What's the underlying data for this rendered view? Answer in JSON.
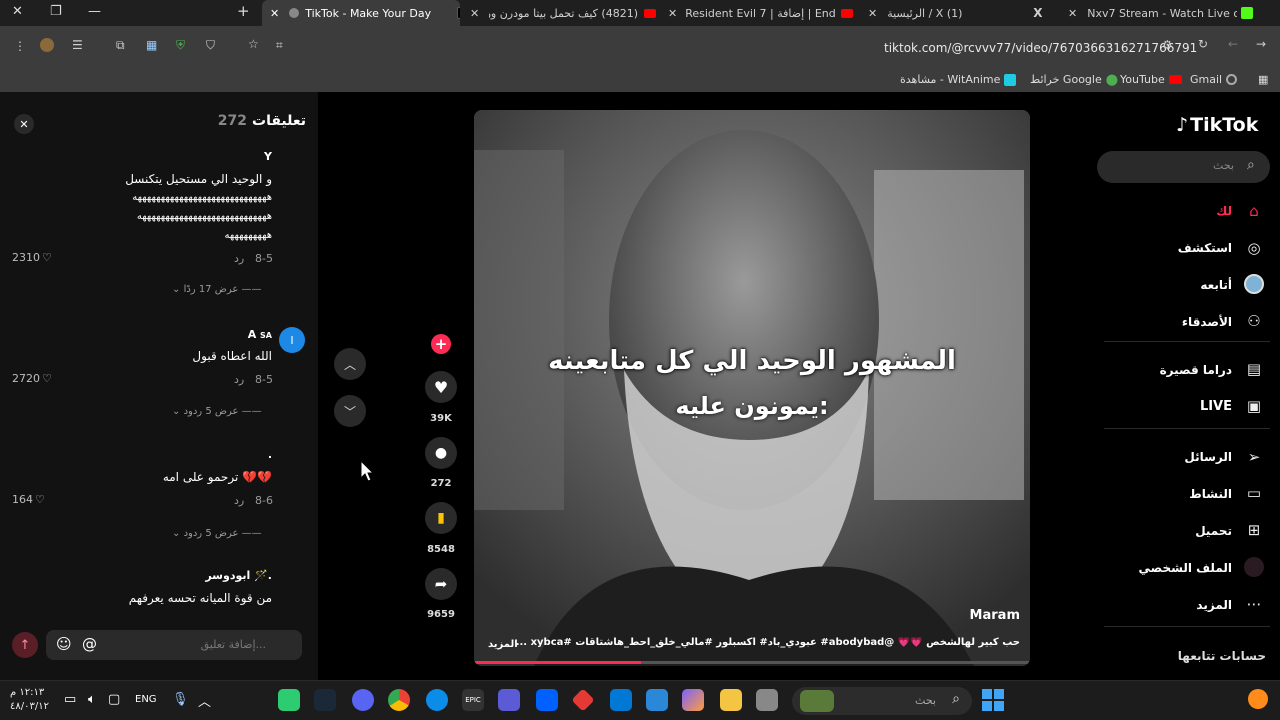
{
  "browser": {
    "tabs": [
      {
        "title": "TikTok - Make Your Day",
        "active": true
      },
      {
        "title": "(4821) كيف تحمل بيتا مودرن ورا..."
      },
      {
        "title": "Resident Evil 7 | إضافة | End of Z"
      },
      {
        "title": "الرئيسية / X (1)"
      },
      {
        "title": "Nxv7 Stream - Watch Live on K"
      }
    ],
    "url": "tiktok.com/@rcvvv77/video/7670366316271766791",
    "bookmarks": [
      "Gmail",
      "YouTube",
      "خرائط Google",
      "مشاهدة - WitAnime"
    ]
  },
  "comments_panel": {
    "title": "تعليقات",
    "count": "272",
    "close_label": "✕",
    "comments": [
      {
        "author": "Y",
        "lines": [
          "و الوحيد الي مستحيل يتكنسل",
          "هههههههههههههههههههههههههههههه",
          "ههههههههههههههههههههههههههههه",
          "هههههههههه"
        ],
        "date": "8-5",
        "reply": "رد",
        "likes": "2310",
        "view_replies": "عرض 17 ردًا"
      },
      {
        "author": "A",
        "author_badge": "SA",
        "lines": [
          "الله اعطاه قبول"
        ],
        "date": "8-5",
        "reply": "رد",
        "likes": "2720",
        "view_replies": "عرض 5 ردود"
      },
      {
        "author": ".",
        "lines": [
          "ترحمو على امه 💔💔"
        ],
        "date": "8-6",
        "reply": "رد",
        "likes": "164",
        "view_replies": "عرض 5 ردود"
      },
      {
        "author": "ابودوسر 🪄.",
        "lines": [
          "من قوة الميانه تحسه يعرفهم"
        ]
      }
    ],
    "input_placeholder": "إضافة تعليق..."
  },
  "video": {
    "caption_line1": "المشهور الوحيد الي كل متابعينه",
    "caption_line2": "يمونون عليه:",
    "author": "Maram",
    "description": "حب كبير لهالشخص 💗💗 @abodybad# عبودي_باد# اكسبلور #مالي_خلق_احط_هاشتاقات #xybca ...",
    "more_label": "المزيد",
    "progress": 0.3
  },
  "actions": {
    "likes": "39K",
    "comments": "272",
    "saves": "8548",
    "shares": "9659"
  },
  "sidebar": {
    "logo": "TikTok",
    "search_placeholder": "بحث",
    "items": [
      {
        "label": "لك",
        "icon": "home-icon"
      },
      {
        "label": "استكشف",
        "icon": "compass-icon"
      },
      {
        "label": "أتابعه",
        "icon": "avatar-icon"
      },
      {
        "label": "الأصدقاء",
        "icon": "friends-icon"
      },
      {
        "label": "دراما قصيرة",
        "icon": "film-icon"
      },
      {
        "label": "LIVE",
        "icon": "live-icon"
      },
      {
        "label": "الرسائل",
        "icon": "send-icon"
      },
      {
        "label": "النشاط",
        "icon": "activity-icon"
      },
      {
        "label": "تحميل",
        "icon": "upload-icon"
      },
      {
        "label": "الملف الشخصي",
        "icon": "profile-icon"
      },
      {
        "label": "المزيد",
        "icon": "more-icon"
      }
    ],
    "following_heading": "حسابات تتابعها"
  },
  "taskbar": {
    "time": "١٢:١٣ م",
    "date": "٤٨/٠٣/١٢",
    "lang": "ENG",
    "search_placeholder": "بحث"
  },
  "colors": {
    "accent": "#fe2c55",
    "save": "#ffc107",
    "bg": "#000000"
  }
}
